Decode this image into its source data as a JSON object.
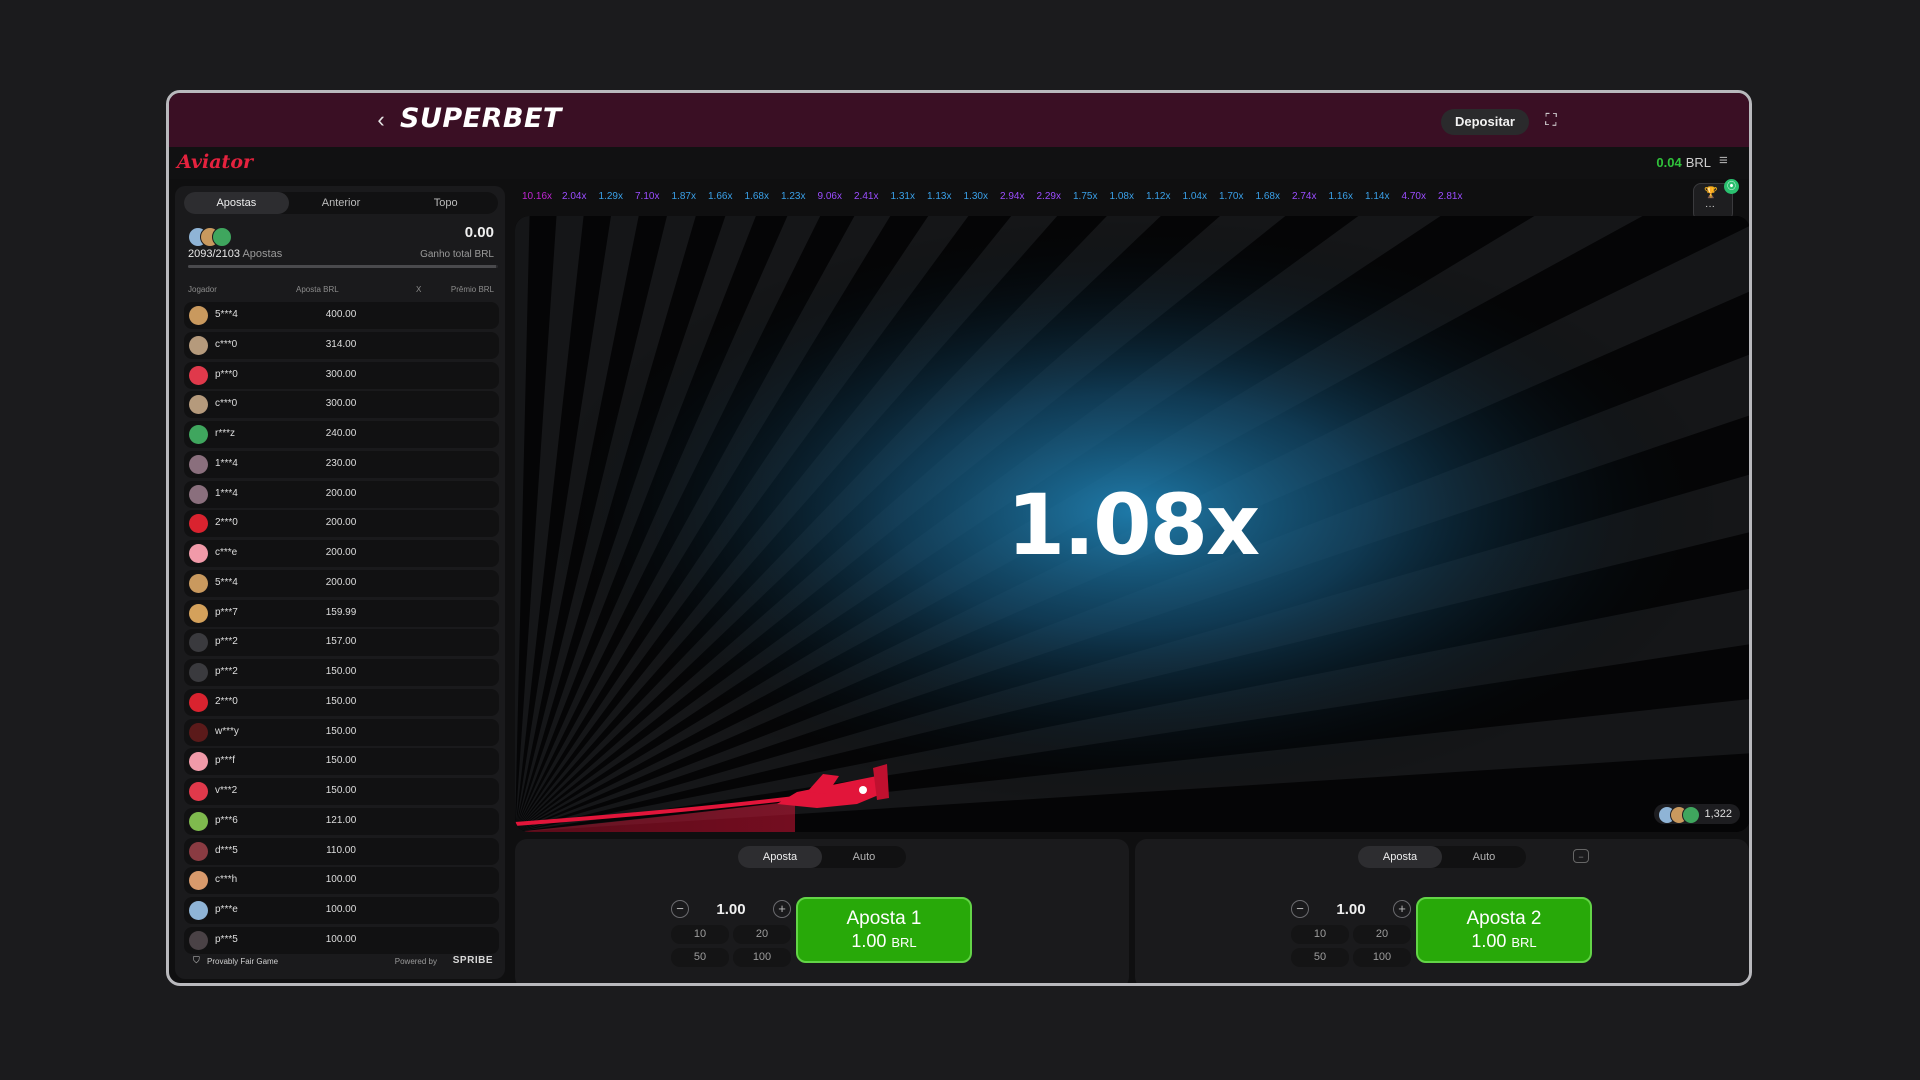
{
  "header": {
    "brand": "SUPERBET",
    "deposit_label": "Depositar"
  },
  "game_bar": {
    "logo": "Aviator",
    "balance": "0.04",
    "currency": "BRL"
  },
  "left_panel": {
    "tabs": [
      "Apostas",
      "Anterior",
      "Topo"
    ],
    "bets_count": "2093/2103",
    "bets_label": "Apostas",
    "total_win": "0.00",
    "total_win_label": "Ganho total BRL",
    "columns": [
      "Jogador",
      "Aposta BRL",
      "X",
      "Prêmio BRL"
    ],
    "rows": [
      {
        "name": "5***4",
        "bet": "400.00",
        "color": "#c9995e"
      },
      {
        "name": "c***0",
        "bet": "314.00",
        "color": "#b59a7c"
      },
      {
        "name": "p***0",
        "bet": "300.00",
        "color": "#e0394b"
      },
      {
        "name": "c***0",
        "bet": "300.00",
        "color": "#b59a7c"
      },
      {
        "name": "r***z",
        "bet": "240.00",
        "color": "#3fa65e"
      },
      {
        "name": "1***4",
        "bet": "230.00",
        "color": "#8a6f7d"
      },
      {
        "name": "1***4",
        "bet": "200.00",
        "color": "#8a6f7d"
      },
      {
        "name": "2***0",
        "bet": "200.00",
        "color": "#d9232f"
      },
      {
        "name": "c***e",
        "bet": "200.00",
        "color": "#f19aa9"
      },
      {
        "name": "5***4",
        "bet": "200.00",
        "color": "#c9995e"
      },
      {
        "name": "p***7",
        "bet": "159.99",
        "color": "#d4a15b"
      },
      {
        "name": "p***2",
        "bet": "157.00",
        "color": "#3a3a3e"
      },
      {
        "name": "p***2",
        "bet": "150.00",
        "color": "#3a3a3e"
      },
      {
        "name": "2***0",
        "bet": "150.00",
        "color": "#d9232f"
      },
      {
        "name": "w***y",
        "bet": "150.00",
        "color": "#5b1a1a"
      },
      {
        "name": "p***f",
        "bet": "150.00",
        "color": "#f19aa9"
      },
      {
        "name": "v***2",
        "bet": "150.00",
        "color": "#e0394b"
      },
      {
        "name": "p***6",
        "bet": "121.00",
        "color": "#7fba4e"
      },
      {
        "name": "d***5",
        "bet": "110.00",
        "color": "#8a3b42"
      },
      {
        "name": "c***h",
        "bet": "100.00",
        "color": "#d89a6c"
      },
      {
        "name": "p***e",
        "bet": "100.00",
        "color": "#8fb4d6"
      },
      {
        "name": "p***5",
        "bet": "100.00",
        "color": "#4a4246"
      }
    ],
    "footer": {
      "provably": "Provably Fair Game",
      "powered_by": "Powered by",
      "provider": "SPRIBE"
    }
  },
  "history": [
    {
      "v": "10.16x",
      "c": "#c026d3"
    },
    {
      "v": "2.04x",
      "c": "#9b4dff"
    },
    {
      "v": "1.29x",
      "c": "#3aa0e8"
    },
    {
      "v": "7.10x",
      "c": "#9b4dff"
    },
    {
      "v": "1.87x",
      "c": "#3aa0e8"
    },
    {
      "v": "1.66x",
      "c": "#3aa0e8"
    },
    {
      "v": "1.68x",
      "c": "#3aa0e8"
    },
    {
      "v": "1.23x",
      "c": "#3aa0e8"
    },
    {
      "v": "9.06x",
      "c": "#9b4dff"
    },
    {
      "v": "2.41x",
      "c": "#9b4dff"
    },
    {
      "v": "1.31x",
      "c": "#3aa0e8"
    },
    {
      "v": "1.13x",
      "c": "#3aa0e8"
    },
    {
      "v": "1.30x",
      "c": "#3aa0e8"
    },
    {
      "v": "2.94x",
      "c": "#9b4dff"
    },
    {
      "v": "2.29x",
      "c": "#9b4dff"
    },
    {
      "v": "1.75x",
      "c": "#3aa0e8"
    },
    {
      "v": "1.08x",
      "c": "#3aa0e8"
    },
    {
      "v": "1.12x",
      "c": "#3aa0e8"
    },
    {
      "v": "1.04x",
      "c": "#3aa0e8"
    },
    {
      "v": "1.70x",
      "c": "#3aa0e8"
    },
    {
      "v": "1.68x",
      "c": "#3aa0e8"
    },
    {
      "v": "2.74x",
      "c": "#9b4dff"
    },
    {
      "v": "1.16x",
      "c": "#3aa0e8"
    },
    {
      "v": "1.14x",
      "c": "#3aa0e8"
    },
    {
      "v": "4.70x",
      "c": "#9b4dff"
    },
    {
      "v": "2.81x",
      "c": "#9b4dff"
    }
  ],
  "history_button": {
    "dots": "···",
    "badge": "⦿"
  },
  "game": {
    "multiplier": "1.08x",
    "online_count": "1,322"
  },
  "bet_panels": [
    {
      "tabs": [
        "Aposta",
        "Auto"
      ],
      "stake": "1.00",
      "quick": [
        "10",
        "20",
        "50",
        "100"
      ],
      "button_label": "Aposta 1",
      "button_amount": "1.00",
      "button_currency": "BRL"
    },
    {
      "tabs": [
        "Aposta",
        "Auto"
      ],
      "stake": "1.00",
      "quick": [
        "10",
        "20",
        "50",
        "100"
      ],
      "button_label": "Aposta 2",
      "button_amount": "1.00",
      "button_currency": "BRL",
      "remove_icon": "−"
    }
  ],
  "icons": {
    "back": "‹",
    "fullscreen": "⛶",
    "menu": "≡",
    "minus": "−",
    "plus": "+",
    "shield": "⛉",
    "trophy": "🏆"
  }
}
